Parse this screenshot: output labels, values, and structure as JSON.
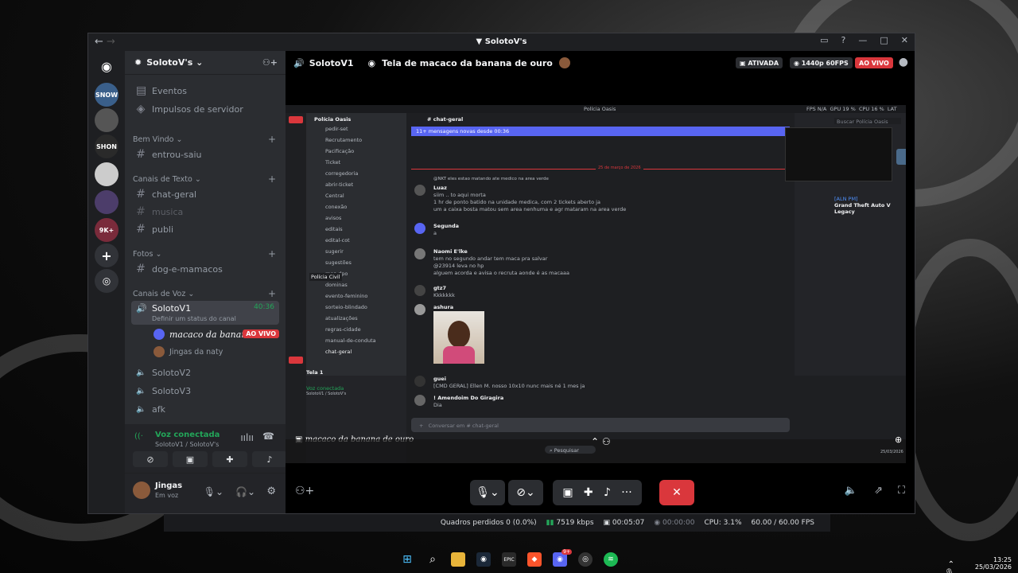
{
  "window": {
    "title": "SolotoV's",
    "nav_back": "←",
    "nav_fwd": "→"
  },
  "server": {
    "name": "SolotoV's",
    "events": "Eventos",
    "boosts": "Impulsos de servidor",
    "categories": {
      "welcome": "Bem Vindo",
      "text": "Canais de Texto",
      "photos": "Fotos",
      "voice": "Canais de Voz"
    },
    "channels": {
      "entrou_saiu": "entrou-saiu",
      "chat_geral": "chat-geral",
      "musica": "musica",
      "publi": "publi",
      "dog": "dog-e-mamacos"
    },
    "voice": {
      "active_name": "SolotoV1",
      "active_time": "40:36",
      "status_hint": "Definir um status do canal",
      "stream_user": "macaco da banana d...",
      "live_badge": "AO VIVO",
      "user2": "Jingas da naty",
      "v2": "SolotoV2",
      "v3": "SolotoV3",
      "afk": "afk"
    }
  },
  "servers_list": [
    {
      "label": "SNOW",
      "color": "#3a5f8a"
    },
    {
      "label": "",
      "color": "#555"
    },
    {
      "label": "SHON",
      "color": "#2a2a2a"
    },
    {
      "label": "",
      "color": "#ccc"
    },
    {
      "label": "",
      "color": "#4c3d6a"
    },
    {
      "label": "9K+",
      "color": "#7a2b3b"
    }
  ],
  "voice_panel": {
    "status": "Voz conectada",
    "location": "SolotoV1 / SolotoV's"
  },
  "user": {
    "name": "Jingas",
    "status": "Em voz"
  },
  "main_header": {
    "channel": "SolotoV1",
    "stream_title": "Tela de macaco da banana de ouro",
    "activated": "ATIVADA",
    "quality": "1440p 60FPS",
    "live": "AO VIVO"
  },
  "stream_inner": {
    "server": "Polícia Oasis",
    "channel": "chat-geral",
    "new_msgs": "11+ mensagens novas desde 00:36",
    "date_sep": "25 de março de 2026",
    "channels": [
      "pedir-set",
      "Recrutamento",
      "Pacificação",
      "Ticket",
      "corregedoria",
      "abrir-ticket",
      "Central",
      "conexão",
      "avisos",
      "editais",
      "edital-cot",
      "sugerir",
      "sugestões",
      "mes-dpo",
      "dominas",
      "evento-feminino",
      "sorteio-blindado",
      "atualizações",
      "regras-cidade",
      "manual-de-conduta",
      "chat-geral"
    ],
    "messages": [
      {
        "name": "Luaz",
        "lines": [
          "siim .. to aqui morta",
          "1 hr de ponto batido na unidade medica, com 2 tickets aberto ja",
          "um a caixa bosta matou sem area nenhuma e agr mataram na area verde"
        ]
      },
      {
        "name": "Segunda",
        "lines": [
          "a"
        ]
      },
      {
        "name": "Naomi E'lke",
        "lines": [
          "tem no segundo andar tem maca pra salvar",
          "@23914 leva no hp",
          "alguem acorda e avisa o recruta aonde é as macaaa"
        ]
      },
      {
        "name": "gtz7",
        "lines": [
          "Kkkkkkk"
        ]
      },
      {
        "name": "ashura",
        "lines": []
      },
      {
        "name": "guei",
        "lines": [
          "[CMD GERAL] Ellen M. nosso 10x10 nunc mais né 1 mes ja"
        ]
      },
      {
        "name": "! Amendoim Do Giragira",
        "lines": [
          "Dia"
        ]
      }
    ],
    "reply_ref": "@NKT eles estao matando ate medico na area verde",
    "composer": "Conversar em # chat-geral",
    "screen_label": "Tela 1",
    "vc": "Voz conectada",
    "vc_loc": "SolotoV1 / SolotoV's",
    "game": "Grand Theft Auto V Legacy",
    "policia_civil": "Polícia Civil",
    "overlay_title": "macaco da banana de ouro",
    "fps": "FPS N/A",
    "gpu": "GPU 19 %",
    "cpu": "CPU 16 %",
    "lat": "LAT N/A",
    "search": "Pesquisar",
    "date": "25/03/2026"
  },
  "statusbar": {
    "frames": "Quadros perdidos 0 (0.0%)",
    "bitrate": "7519 kbps",
    "time": "00:05:07",
    "time2": "00:00:00",
    "cpu": "CPU: 3.1%",
    "fps": "60.00 / 60.00 FPS"
  },
  "taskbar": {
    "time": "13:25",
    "date": "25/03/2026",
    "discord_badge": "9+"
  },
  "colors": {
    "accent": "#5865f2",
    "live_red": "#da373c",
    "green": "#23a559"
  }
}
